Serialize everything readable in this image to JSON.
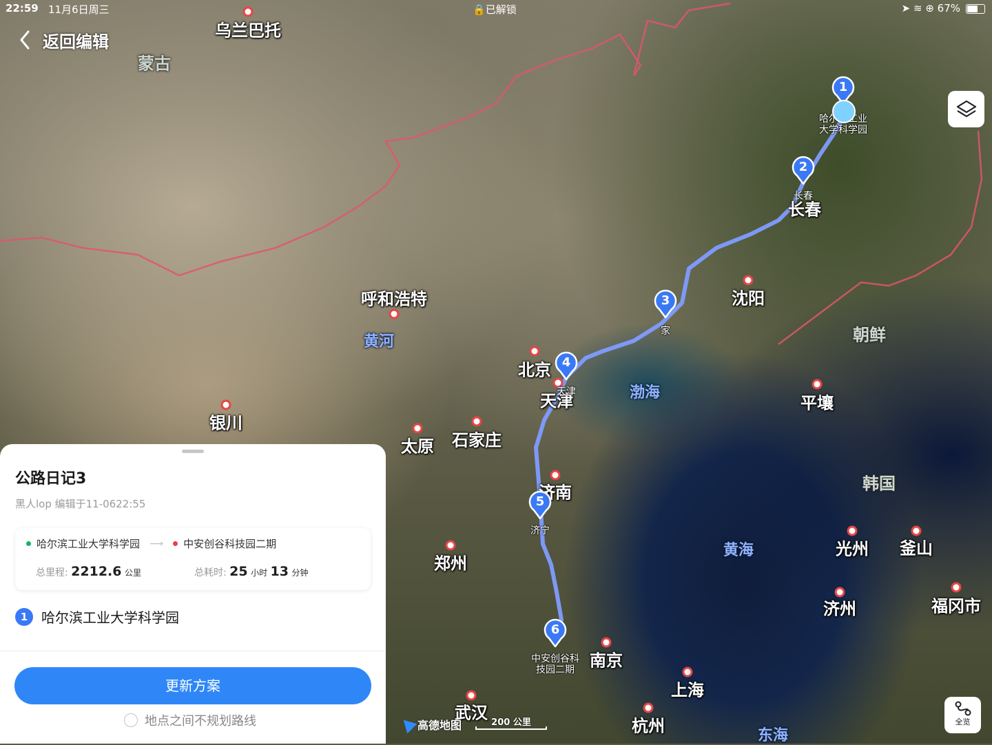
{
  "status_bar": {
    "time": "22:59",
    "date": "11月6日周三",
    "lock_text": "已解锁",
    "battery": "67%"
  },
  "nav": {
    "back_label": "返回编辑"
  },
  "map": {
    "regions": [
      {
        "name": "乌兰巴托",
        "kind": "city"
      },
      {
        "name": "蒙古",
        "kind": "region"
      },
      {
        "name": "呼和浩特",
        "kind": "city"
      },
      {
        "name": "黄河",
        "kind": "water"
      },
      {
        "name": "银川",
        "kind": "city"
      },
      {
        "name": "北京",
        "kind": "city"
      },
      {
        "name": "天津",
        "kind": "city"
      },
      {
        "name": "太原",
        "kind": "city"
      },
      {
        "name": "石家庄",
        "kind": "city"
      },
      {
        "name": "济南",
        "kind": "city"
      },
      {
        "name": "郑州",
        "kind": "city"
      },
      {
        "name": "武汉",
        "kind": "city"
      },
      {
        "name": "南京",
        "kind": "city"
      },
      {
        "name": "上海",
        "kind": "city"
      },
      {
        "name": "杭州",
        "kind": "city"
      },
      {
        "name": "沈阳",
        "kind": "city"
      },
      {
        "name": "长春",
        "kind": "city"
      },
      {
        "name": "平壤",
        "kind": "city"
      },
      {
        "name": "朝鲜",
        "kind": "region"
      },
      {
        "name": "韩国",
        "kind": "region"
      },
      {
        "name": "光州",
        "kind": "city"
      },
      {
        "name": "釜山",
        "kind": "city"
      },
      {
        "name": "济州",
        "kind": "city"
      },
      {
        "name": "福冈市",
        "kind": "city"
      },
      {
        "name": "渤海",
        "kind": "water"
      },
      {
        "name": "黄海",
        "kind": "water"
      },
      {
        "name": "东海",
        "kind": "water"
      }
    ],
    "markers": [
      {
        "num": "1",
        "label_line1": "哈尔滨工业",
        "label_line2": "大学科学园"
      },
      {
        "num": "2",
        "label_line1": "长春",
        "label_line2": ""
      },
      {
        "num": "3",
        "label_line1": "家",
        "label_line2": ""
      },
      {
        "num": "4",
        "label_line1": "天津",
        "label_line2": ""
      },
      {
        "num": "5",
        "label_line1": "济宁",
        "label_line2": ""
      },
      {
        "num": "6",
        "label_line1": "中安创谷科",
        "label_line2": "技园二期"
      }
    ],
    "brand": "高德地图",
    "scale_label": "200 公里",
    "overview_label": "全览",
    "route_color": "#7f9cff",
    "marker_color": "#3a79f5",
    "border_color": "#e0566a"
  },
  "panel": {
    "title": "公路日记3",
    "meta": "黑人lop 编辑于11-0622:55",
    "origin": "哈尔滨工业大学科学园",
    "destination": "中安创谷科技园二期",
    "distance_label": "总里程:",
    "distance_value": "2212.6",
    "distance_unit": "公里",
    "duration_label": "总耗时:",
    "duration_hours": "25",
    "duration_hours_unit": "小时",
    "duration_minutes": "13",
    "duration_minutes_unit": "分钟",
    "first_stop_num": "1",
    "first_stop_name": "哈尔滨工业大学科学园",
    "update_button": "更新方案",
    "no_route_checkbox": "地点之间不规划路线"
  }
}
